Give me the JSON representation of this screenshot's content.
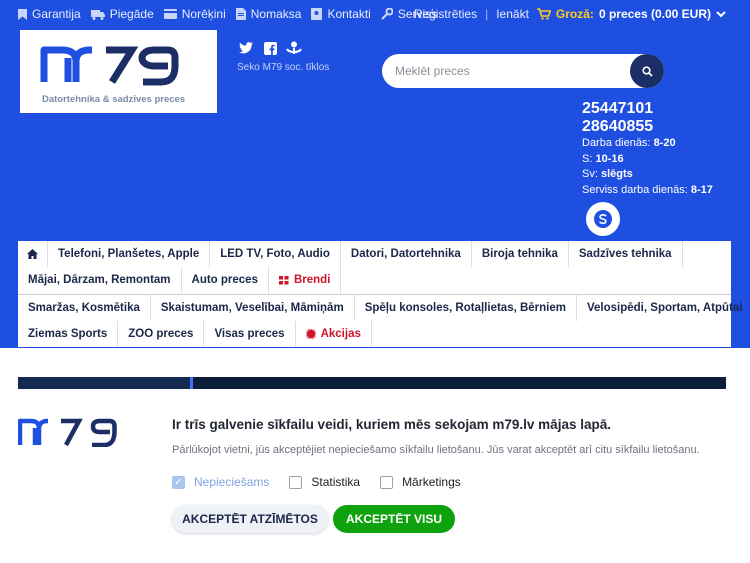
{
  "topbar": {
    "links": [
      {
        "label": "Garantija",
        "icon": "bookmark-icon"
      },
      {
        "label": "Piegāde",
        "icon": "truck-icon"
      },
      {
        "label": "Norēķini",
        "icon": "card-icon"
      },
      {
        "label": "Nomaksa",
        "icon": "document-icon"
      },
      {
        "label": "Kontakti",
        "icon": "phone-icon"
      },
      {
        "label": "Serviss",
        "icon": "wrench-icon"
      }
    ],
    "register": "Reģistrēties",
    "login": "Ienākt",
    "cart_label": "Grozā:",
    "cart_value": "0 preces (0.00 EUR)"
  },
  "header": {
    "logo_text": "m79",
    "logo_tagline": "Datortehnika & sadzīves preces",
    "social_label": "Seko M79 soc. tīklos",
    "search_placeholder": "Meklēt preces",
    "phone1": "25447101",
    "phone2": "28640855",
    "hours": [
      {
        "label": "Darba dienās:",
        "value": "8-20"
      },
      {
        "label": "S:",
        "value": "10-16"
      },
      {
        "label": "Sv:",
        "value": "slēgts"
      },
      {
        "label": "Serviss darba dienās:",
        "value": "8-17"
      }
    ]
  },
  "nav": {
    "row1": [
      "Telefoni, Planšetes, Apple",
      "LED TV, Foto, Audio",
      "Datori, Datortehnika",
      "Biroja tehnika",
      "Sadzīves tehnika"
    ],
    "row2": [
      "Mājai, Dārzam, Remontam",
      "Auto preces",
      "Brendi"
    ],
    "row3": [
      "Smaržas, Kosmētika",
      "Skaistumam, Veselībai, Māmiņām",
      "Spēļu konsoles, Rotaļlietas, Bērniem",
      "Velosipēdi, Sportam, Atpūtai"
    ],
    "row4": [
      "Ziemas Sports",
      "ZOO preces",
      "Visas preces",
      "Akcijas"
    ]
  },
  "cookie": {
    "title": "Ir trīs galvenie sīkfailu veidi, kuriem mēs sekojam m79.lv mājas lapā.",
    "description": "Pārlūkojot vietni, jūs akceptējiet nepieciešamo sīkfailu lietošanu. Jūs varat akceptēt arī citu sīkfailu lietošanu.",
    "options": [
      {
        "label": "Nepieciešams",
        "checked": true
      },
      {
        "label": "Statistika",
        "checked": false
      },
      {
        "label": "Mārketings",
        "checked": false
      }
    ],
    "accept_selected": "AKCEPTĒT ATZĪMĒTOS",
    "accept_all": "AKCEPTĒT VISU"
  },
  "colors": {
    "brand_blue": "#1f4fe0",
    "navy": "#1b2f66",
    "accent_red": "#d0132b",
    "cart_yellow": "#ffcc22",
    "accept_green": "#0ea30e"
  }
}
